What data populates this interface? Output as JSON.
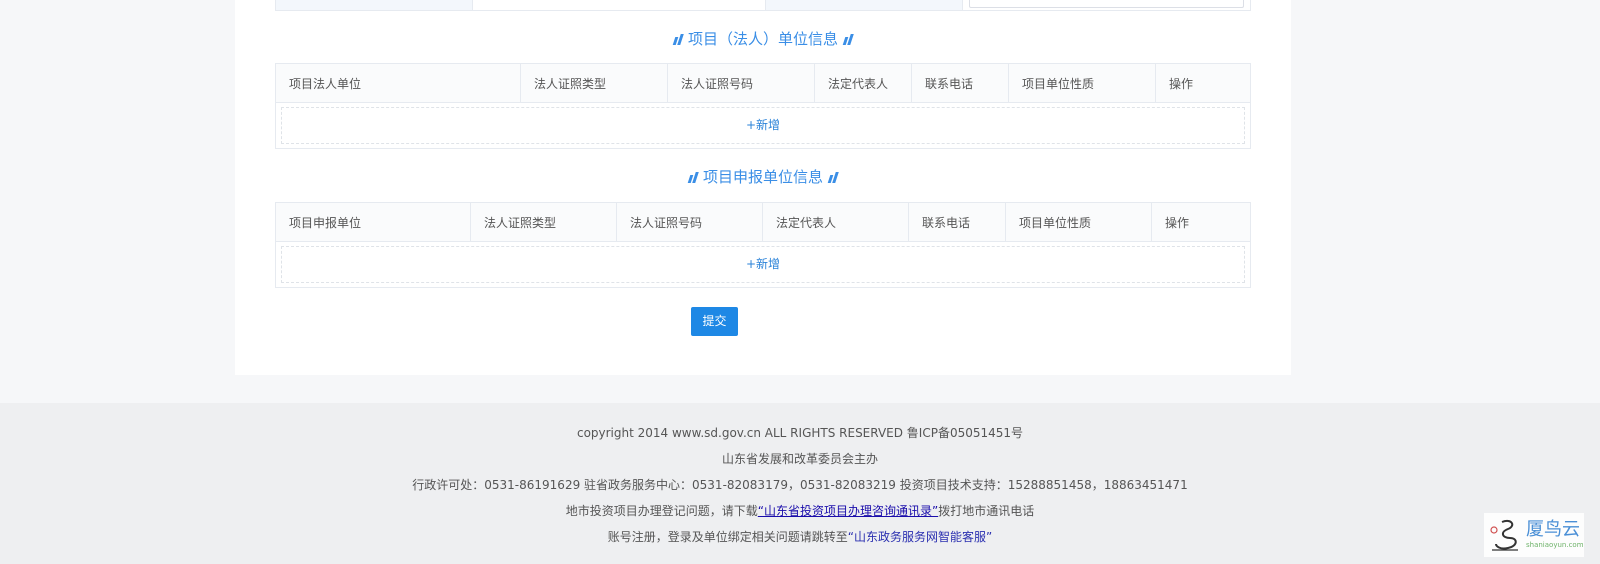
{
  "section_legal": {
    "title": "项目（法人）单位信息",
    "columns": [
      "项目法人单位",
      "法人证照类型",
      "法人证照号码",
      "法定代表人",
      "联系电话",
      "项目单位性质",
      "操作"
    ],
    "add_label": "+新增"
  },
  "section_applicant": {
    "title": "项目申报单位信息",
    "columns": [
      "项目申报单位",
      "法人证照类型",
      "法人证照号码",
      "法定代表人",
      "联系电话",
      "项目单位性质",
      "操作"
    ],
    "add_label": "+新增"
  },
  "submit_label": "提交",
  "footer": {
    "copyright": "copyright 2014 www.sd.gov.cn ALL RIGHTS RESERVED 鲁ICP备05051451号",
    "host": "山东省发展和改革委员会主办",
    "contacts": "行政许可处：0531-86191629 驻省政务服务中心：0531-82083179，0531-82083219 投资项目技术支持：15288851458，18863451471",
    "city_prefix": "地市投资项目办理登记问题，请下载",
    "city_link": "“山东省投资项目办理咨询通讯录”",
    "city_suffix": "拨打地市通讯电话",
    "account_prefix": "账号注册，登录及单位绑定相关问题请跳转至",
    "account_link": "“山东政务服务网智能客服”"
  },
  "watermark": {
    "main": "厦鸟云",
    "sub": "shaniaoyun.com"
  },
  "colors": {
    "accent": "#3a8ee6",
    "button": "#1e88e5",
    "link": "#1a0dab"
  }
}
